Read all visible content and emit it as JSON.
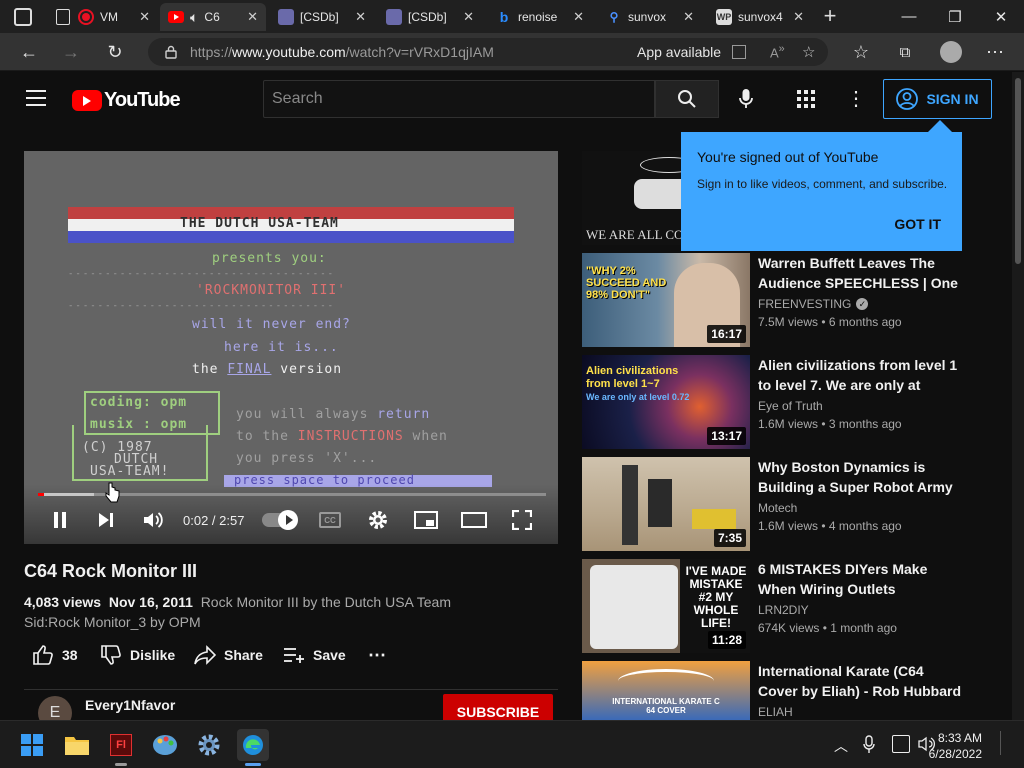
{
  "browser": {
    "tabs": [
      {
        "label": "VM",
        "icon": "record-icon",
        "active": false
      },
      {
        "label": "C6",
        "icon": "youtube-icon",
        "active": true
      },
      {
        "label": "[CSDb]",
        "icon": "csdb-icon",
        "active": false
      },
      {
        "label": "[CSDb]",
        "icon": "csdb-icon",
        "active": false
      },
      {
        "label": "renoise",
        "icon": "bing-icon",
        "active": false
      },
      {
        "label": "sunvox",
        "icon": "search-icon",
        "active": false
      },
      {
        "label": "sunvox4",
        "icon": "wp-icon",
        "active": false
      }
    ],
    "url_prefix": "https://",
    "url_host": "www.youtube.com",
    "url_path": "/watch?v=rVRxD1qjIAM",
    "app_available": "App available"
  },
  "youtube": {
    "logo_text": "YouTube",
    "search_placeholder": "Search",
    "sign_in": "SIGN IN"
  },
  "player": {
    "screen_lines": {
      "banner": "THE DUTCH USA-TEAM",
      "presents": "presents you:",
      "rule1": "------------------------------------",
      "title": "'ROCKMONITOR III'",
      "rule2": "------------------------------------",
      "never_end": "will it never end?",
      "here": "here it is...",
      "the": "the",
      "final": "FINAL",
      "version": "version",
      "coding": "coding: opm",
      "musix": "musix : opm",
      "copyright1": "(C) 1987",
      "copyright2": "DUTCH",
      "copyright3": "USA-TEAM!",
      "always": "you will always",
      "return": "return",
      "to_the": "to the",
      "instructions": "INSTRUCTIONS",
      "when": "when",
      "you_press": "you press 'X'...",
      "press_space": "press space to proceed"
    },
    "time_current": "0:02",
    "time_separator": " / ",
    "time_total": "2:57",
    "progress_fraction": 0.011,
    "buffer_fraction": 0.11
  },
  "video": {
    "title": "C64 Rock Monitor III",
    "views": "4,083 views",
    "date": "Nov 16, 2011",
    "description_line1": "Rock Monitor III by the Dutch  USA Team",
    "description_line2": "Sid:Rock Monitor_3 by OPM",
    "likes": "38",
    "dislike_label": "Dislike",
    "share_label": "Share",
    "save_label": "Save",
    "channel_name": "Every1Nfavor",
    "channel_initial": "E",
    "subscribe_label": "SUBSCRIBE"
  },
  "popup": {
    "title": "You're signed out of YouTube",
    "body": "Sign in to like videos, comment, and subscribe.",
    "button": "GOT IT"
  },
  "recommendations": [
    {
      "title": "",
      "channel": "",
      "meta": "",
      "duration": "",
      "thumb_text": "WE ARE ALL CO"
    },
    {
      "title": "Warren Buffett Leaves The Audience SPEECHLESS | One ...",
      "channel": "FREENVESTING",
      "verified": true,
      "meta": "7.5M views • 6 months ago",
      "duration": "16:17",
      "thumb_text": "\"WHY 2% SUCCEED AND 98% DON'T\""
    },
    {
      "title": "Alien civilizations from level 1 to level 7. We are only at level...",
      "channel": "Eye of Truth",
      "meta": "1.6M views • 3 months ago",
      "duration": "13:17",
      "thumb_text": "Alien civilizations from level 1~7",
      "thumb_text2": "We are only at level 0.72"
    },
    {
      "title": "Why Boston Dynamics is Building a Super Robot Army",
      "channel": "Motech",
      "meta": "1.6M views • 4 months ago",
      "duration": "7:35"
    },
    {
      "title": "6 MISTAKES DIYers Make When Wiring Outlets",
      "channel": "LRN2DIY",
      "meta": "674K views • 1 month ago",
      "duration": "11:28",
      "thumb_text": "I'VE MADE MISTAKE #2 MY WHOLE LIFE!"
    },
    {
      "title": "International Karate (C64 Cover by Eliah) - Rob Hubbard",
      "channel": "ELIAH",
      "meta": "",
      "duration": "",
      "thumb_text": "INTERNATIONAL KARATE C 64 COVER"
    }
  ],
  "taskbar": {
    "time": "8:33 AM",
    "date": "6/28/2022"
  },
  "colors": {
    "accent_blue": "#3ea6ff",
    "youtube_red": "#ff0000",
    "subscribe_red": "#cc0000",
    "c64_green": "#9fcf7f",
    "c64_lilac": "#a8a6e8",
    "c64_red": "#e07070"
  }
}
